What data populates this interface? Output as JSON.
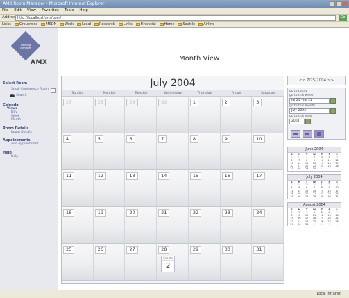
{
  "window": {
    "title": "AMX Room Manager - Microsoft Internet Explorer"
  },
  "menu": [
    "File",
    "Edit",
    "View",
    "Favorites",
    "Tools",
    "Help"
  ],
  "address": {
    "label": "Address",
    "value": "http://localhost/rms/user/",
    "go_label": "Go"
  },
  "links": {
    "label": "Links",
    "items": [
      "Groupwise",
      "MSDN",
      "Work",
      "Local",
      "Research",
      "Links",
      "Financial",
      "Home",
      "Seattle",
      "Airline"
    ]
  },
  "sidebar": {
    "logo_text": "Meeting Manager",
    "brand": "AMX",
    "select_room_heading": "Select Room",
    "room_item": "Small Conference Room",
    "search_label": "Search",
    "calendar_heading": "Calendar",
    "views_heading": "Views",
    "view_items": [
      "Day",
      "Week",
      "Month"
    ],
    "room_details_heading": "Room Details",
    "room_details_item": "Room Details",
    "appointments_heading": "Appointments",
    "appointments_item": "Add Appointment",
    "help_heading": "Help",
    "help_item": "Help"
  },
  "main": {
    "page_title": "Month View",
    "calendar_title": "July 2004",
    "weekdays": [
      "Sunday",
      "Monday",
      "Tuesday",
      "Wednesday",
      "Thursday",
      "Friday",
      "Saturday"
    ],
    "weeks": [
      [
        "27",
        "28",
        "29",
        "30",
        "1",
        "2",
        "3"
      ],
      [
        "4",
        "5",
        "6",
        "7",
        "8",
        "9",
        "10"
      ],
      [
        "11",
        "12",
        "13",
        "14",
        "15",
        "16",
        "17"
      ],
      [
        "18",
        "19",
        "20",
        "21",
        "22",
        "23",
        "24"
      ],
      [
        "25",
        "26",
        "27",
        "28",
        "29",
        "30",
        "31"
      ]
    ],
    "event": {
      "label": "Events",
      "count": "2"
    }
  },
  "right": {
    "date_nav": "<< 7/25/2004 >>",
    "goto_today": "go to today",
    "goto_week_label": "go to this week",
    "goto_week_value": "Jul 25 - Jul 31",
    "goto_month_label": "go to this month",
    "goto_month_value": "July 2004",
    "goto_year_label": "go to this year",
    "goto_year_value": "2004",
    "mini_calendars": [
      {
        "title": "June 2004",
        "days_header": [
          "S",
          "M",
          "T",
          "W",
          "T",
          "F",
          "S"
        ],
        "rows": [
          [
            "30",
            "31",
            "1",
            "2",
            "3",
            "4",
            "5"
          ],
          [
            "6",
            "7",
            "8",
            "9",
            "10",
            "11",
            "12"
          ],
          [
            "13",
            "14",
            "15",
            "16",
            "17",
            "18",
            "19"
          ],
          [
            "20",
            "21",
            "22",
            "23",
            "24",
            "25",
            "26"
          ],
          [
            "27",
            "28",
            "29",
            "30",
            "1",
            "2",
            "3"
          ]
        ]
      },
      {
        "title": "July 2004",
        "days_header": [
          "S",
          "M",
          "T",
          "W",
          "T",
          "F",
          "S"
        ],
        "rows": [
          [
            "27",
            "28",
            "29",
            "30",
            "1",
            "2",
            "3"
          ],
          [
            "4",
            "5",
            "6",
            "7",
            "8",
            "9",
            "10"
          ],
          [
            "11",
            "12",
            "13",
            "14",
            "15",
            "16",
            "17"
          ],
          [
            "18",
            "19",
            "20",
            "21",
            "22",
            "23",
            "24"
          ],
          [
            "25",
            "26",
            "27",
            "28",
            "29",
            "30",
            "31"
          ]
        ]
      },
      {
        "title": "August 2004",
        "days_header": [
          "S",
          "M",
          "T",
          "W",
          "T",
          "F",
          "S"
        ],
        "rows": [
          [
            "1",
            "2",
            "3",
            "4",
            "5",
            "6",
            "7"
          ],
          [
            "8",
            "9",
            "10",
            "11",
            "12",
            "13",
            "14"
          ],
          [
            "15",
            "16",
            "17",
            "18",
            "19",
            "20",
            "21"
          ],
          [
            "22",
            "23",
            "24",
            "25",
            "26",
            "27",
            "28"
          ],
          [
            "29",
            "30",
            "31",
            "1",
            "2",
            "3",
            "4"
          ]
        ]
      }
    ]
  },
  "status": {
    "zone": "Local intranet"
  },
  "colors": {
    "accent": "#6b76a6",
    "nav_text": "#3c4a7a"
  }
}
